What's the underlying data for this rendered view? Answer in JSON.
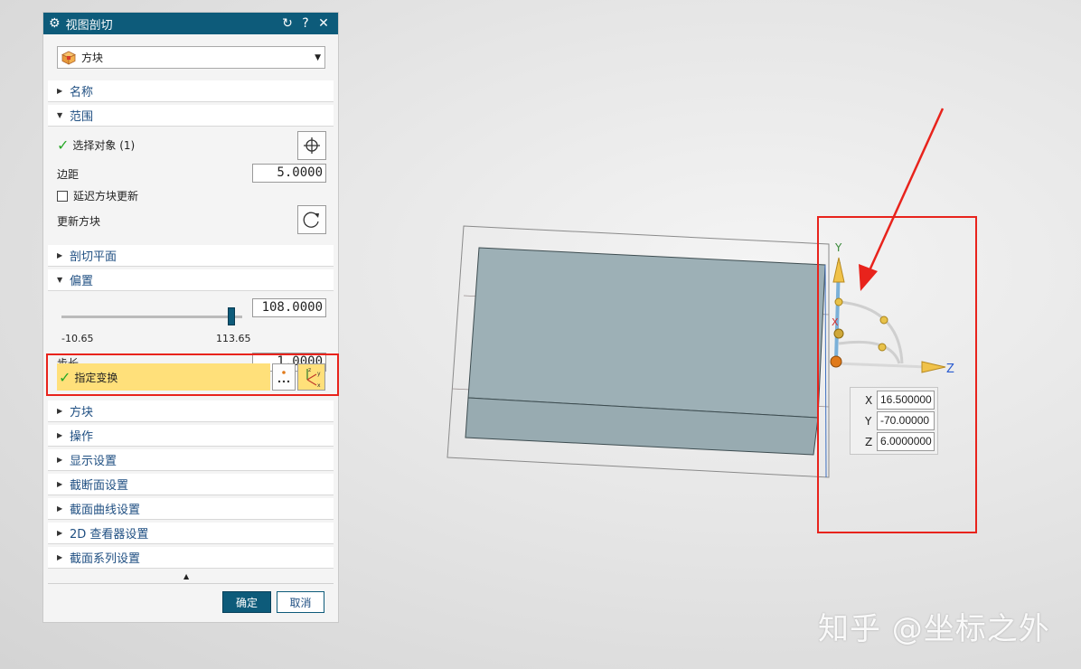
{
  "dialog": {
    "title": "视图剖切",
    "type_selected": "方块",
    "sections": {
      "name": "名称",
      "range": "范围",
      "cut_plane": "剖切平面",
      "offset": "偏置",
      "block": "方块",
      "operation": "操作",
      "display_settings": "显示设置",
      "section_face_settings": "截断面设置",
      "section_curve_settings": "截面曲线设置",
      "viewer_2d_settings": "2D 查看器设置",
      "section_series_settings": "截面系列设置"
    },
    "range": {
      "select_object": "选择对象 (1)",
      "margin_label": "边距",
      "margin_value": "5.0000",
      "delay_update_label": "延迟方块更新",
      "update_block_label": "更新方块"
    },
    "offset": {
      "value": "108.0000",
      "min_label": "-10.65",
      "max_label": "113.65",
      "step_label": "步长",
      "step_value": "1.0000",
      "specify_transform": "指定变换",
      "slider_fraction": 0.94
    },
    "buttons": {
      "ok": "确定",
      "cancel": "取消"
    }
  },
  "coordinates": {
    "x_label": "X",
    "x_value": "16.500000",
    "y_label": "Y",
    "y_value": "-70.00000",
    "z_label": "Z",
    "z_value": "6.0000000"
  },
  "axes": {
    "y": "Y",
    "z": "Z",
    "x": "X"
  },
  "transform_icon_letters": {
    "z": "z",
    "y": "y",
    "x": "x"
  },
  "watermark": "知乎 @坐标之外",
  "colors": {
    "title_bar": "#0d5b7a",
    "highlight": "#ffe07a",
    "annotation_red": "#e8231c"
  }
}
